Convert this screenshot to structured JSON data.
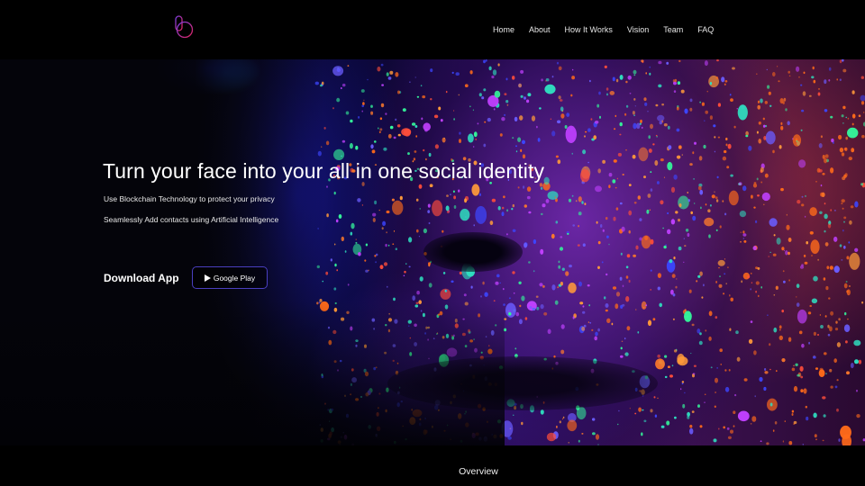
{
  "header": {
    "logo_icon": "brand-logo-b-circle",
    "logo_colors": [
      "#7b3fe4",
      "#e0245e"
    ],
    "nav": [
      {
        "label": "Home"
      },
      {
        "label": "About"
      },
      {
        "label": "How It Works"
      },
      {
        "label": "Vision"
      },
      {
        "label": "Team"
      },
      {
        "label": "FAQ"
      }
    ]
  },
  "hero": {
    "headline": "Turn your face into your all in one social identity",
    "taglines": [
      "Use Blockchain Technology to protect your privacy",
      "Seamlessly Add contacts using Artificial Intelligence"
    ],
    "download_label": "Download App",
    "google_play_button": {
      "icon": "play-icon",
      "label": "Google Play",
      "border_color": "#4a3fbf"
    },
    "background_image": "neon-speckled-face"
  },
  "overview": {
    "title": "Overview"
  }
}
